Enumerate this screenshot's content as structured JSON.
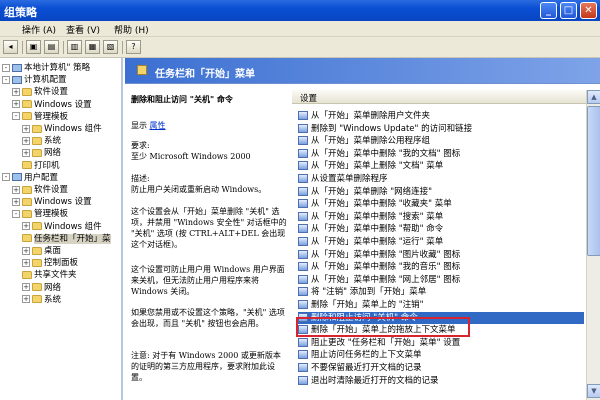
{
  "window": {
    "title": "组策略"
  },
  "menu": [
    "操作 (A)",
    "查看 (V)",
    "帮助 (H)"
  ],
  "tree": [
    {
      "label": "本地计算机\" 策略",
      "indent": 0,
      "exp": "-",
      "icon": "pc"
    },
    {
      "label": "计算机配置",
      "indent": 0,
      "exp": "-",
      "icon": "pc"
    },
    {
      "label": "软件设置",
      "indent": 1,
      "exp": "+",
      "icon": "folder"
    },
    {
      "label": "Windows 设置",
      "indent": 1,
      "exp": "+",
      "icon": "folder"
    },
    {
      "label": "管理模板",
      "indent": 1,
      "exp": "-",
      "icon": "folder"
    },
    {
      "label": "Windows 组件",
      "indent": 2,
      "exp": "+",
      "icon": "folder"
    },
    {
      "label": "系统",
      "indent": 2,
      "exp": "+",
      "icon": "folder"
    },
    {
      "label": "网络",
      "indent": 2,
      "exp": "+",
      "icon": "folder"
    },
    {
      "label": "打印机",
      "indent": 2,
      "exp": "",
      "icon": "folder"
    },
    {
      "label": "用户配置",
      "indent": 0,
      "exp": "-",
      "icon": "pc"
    },
    {
      "label": "软件设置",
      "indent": 1,
      "exp": "+",
      "icon": "folder"
    },
    {
      "label": "Windows 设置",
      "indent": 1,
      "exp": "+",
      "icon": "folder"
    },
    {
      "label": "管理模板",
      "indent": 1,
      "exp": "-",
      "icon": "folder"
    },
    {
      "label": "Windows 组件",
      "indent": 2,
      "exp": "+",
      "icon": "folder"
    },
    {
      "label": "任务栏和「开始」菜",
      "indent": 2,
      "exp": "",
      "icon": "folder",
      "selected": true
    },
    {
      "label": "桌面",
      "indent": 2,
      "exp": "+",
      "icon": "folder"
    },
    {
      "label": "控制面板",
      "indent": 2,
      "exp": "+",
      "icon": "folder"
    },
    {
      "label": "共享文件夹",
      "indent": 2,
      "exp": "",
      "icon": "folder"
    },
    {
      "label": "网络",
      "indent": 2,
      "exp": "+",
      "icon": "folder"
    },
    {
      "label": "系统",
      "indent": 2,
      "exp": "+",
      "icon": "folder"
    }
  ],
  "header": {
    "title": "任务栏和「开始」菜单"
  },
  "description": {
    "title": "删除和阻止访问 \"关机\" 命令",
    "show_label": "显示",
    "show_link": "属性",
    "requirement_label": "要求:",
    "requirement": "至少 Microsoft Windows 2000",
    "desc_label": "描述:",
    "desc1": "防止用户关闭或重新启动 Windows。",
    "desc2": "这个设置会从「开始」菜单删除 \"关机\" 选项，并禁用 \"Windows 安全性\" 对话框中的 \"关机\" 选项 (按 CTRL+ALT+DEL 会出现这个对话框)。",
    "desc3": "这个设置可防止用户用 Windows 用户界面来关机，但无法防止用户用程序来将 Windows 关闭。",
    "desc4": "如果您禁用或不设置这个策略，\"关机\" 选项会出现，而且 \"关机\" 按钮也会启用。",
    "desc5": "注意: 对于有 Windows 2000 或更新版本的证明的第三方应用程序，要求附加此设置。"
  },
  "list": {
    "column": "设置",
    "items": [
      "从「开始」菜单删除用户文件夹",
      "删除到 \"Windows Update\" 的访问和链接",
      "从「开始」菜单删除公用程序组",
      "从「开始」菜单中删除 \"我的文档\" 图标",
      "从「开始」菜单上删除 \"文档\" 菜单",
      "从设置菜单删除程序",
      "从「开始」菜单删除 \"网络连接\"",
      "从「开始」菜单中删除 \"收藏夹\" 菜单",
      "从「开始」菜单中删除 \"搜索\" 菜单",
      "从「开始」菜单中删除 \"帮助\" 命令",
      "从「开始」菜单中删除 \"运行\" 菜单",
      "从「开始」菜单中删除 \"图片收藏\" 图标",
      "从「开始」菜单中删除 \"我的音乐\" 图标",
      "从「开始」菜单中删除 \"网上邻居\" 图标",
      "将 \"注销\" 添加到「开始」菜单",
      "删除「开始」菜单上的 \"注销\"",
      "删除和阻止访问 \"关机\" 命令",
      "删除「开始」菜单上的拖放上下文菜单",
      "阻止更改 \"任务栏和「开始」菜单\" 设置",
      "阻止访问任务栏的上下文菜单",
      "不要保留最近打开文档的记录",
      "退出时清除最近打开的文档的记录"
    ],
    "selected_index": 16
  },
  "colors": {
    "title_bar": "#0a4fd3",
    "selection": "#316ac5",
    "highlight_box": "#d8242e"
  }
}
